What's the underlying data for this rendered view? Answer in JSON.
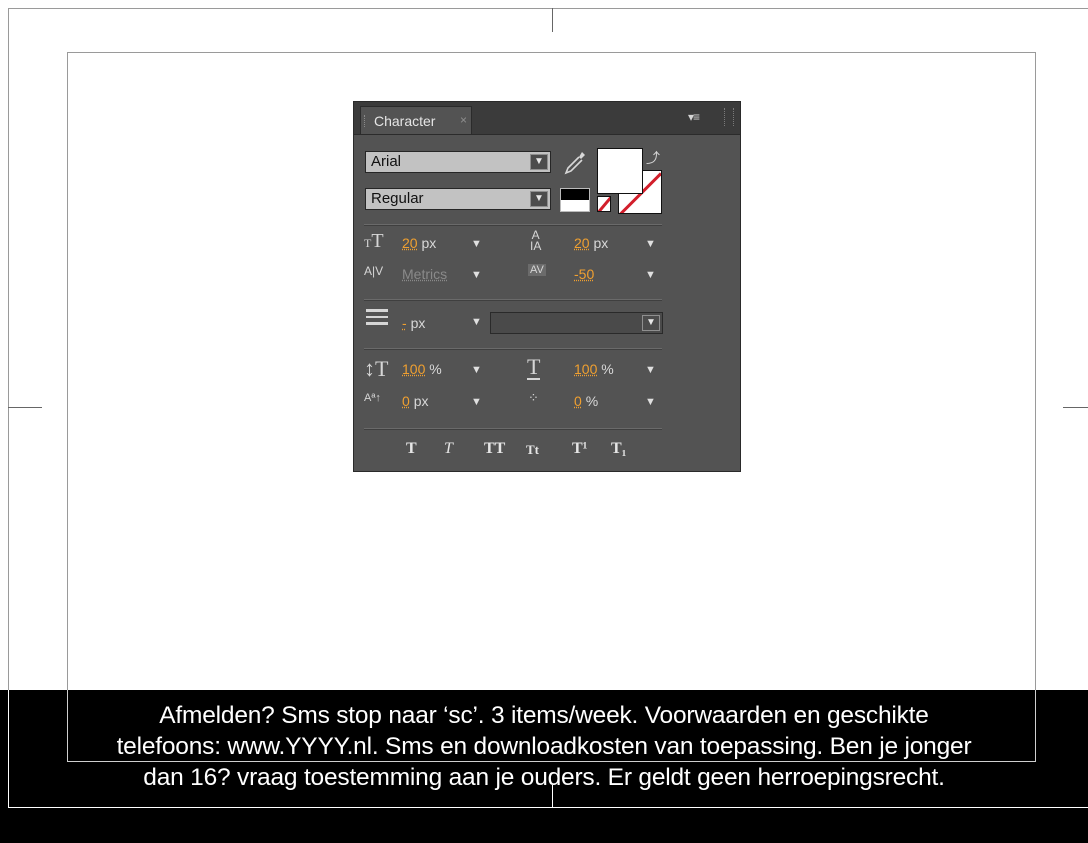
{
  "panel": {
    "title": "Character",
    "close": "×",
    "font_family": "Arial",
    "font_style": "Regular",
    "font_size": {
      "value": "20",
      "unit": "px"
    },
    "leading": {
      "value": "20",
      "unit": "px"
    },
    "kerning": {
      "value": "Metrics"
    },
    "tracking": {
      "value": "-50"
    },
    "stroke_width": {
      "value": "-",
      "unit": "px"
    },
    "vertical_scale": {
      "value": "100",
      "unit": "%"
    },
    "horizontal_scale": {
      "value": "100",
      "unit": "%"
    },
    "baseline_shift": {
      "value": "0",
      "unit": "px"
    },
    "tsume": {
      "value": "0",
      "unit": "%"
    },
    "style_buttons": [
      "T",
      "T",
      "TT",
      "Tt",
      "T¹",
      "T₁"
    ],
    "fill_color": "#ffffff",
    "accent_color": "#f0a030"
  },
  "subtitle": {
    "lines": [
      "Afmelden? Sms stop naar ‘sc’. 3 items/week. Voorwaarden en geschikte",
      "telefoons: www.YYYY.nl. Sms en downloadkosten van toepassing. Ben je jonger",
      "dan 16? vraag toestemming aan je ouders. Er geldt geen herroepingsrecht."
    ]
  }
}
